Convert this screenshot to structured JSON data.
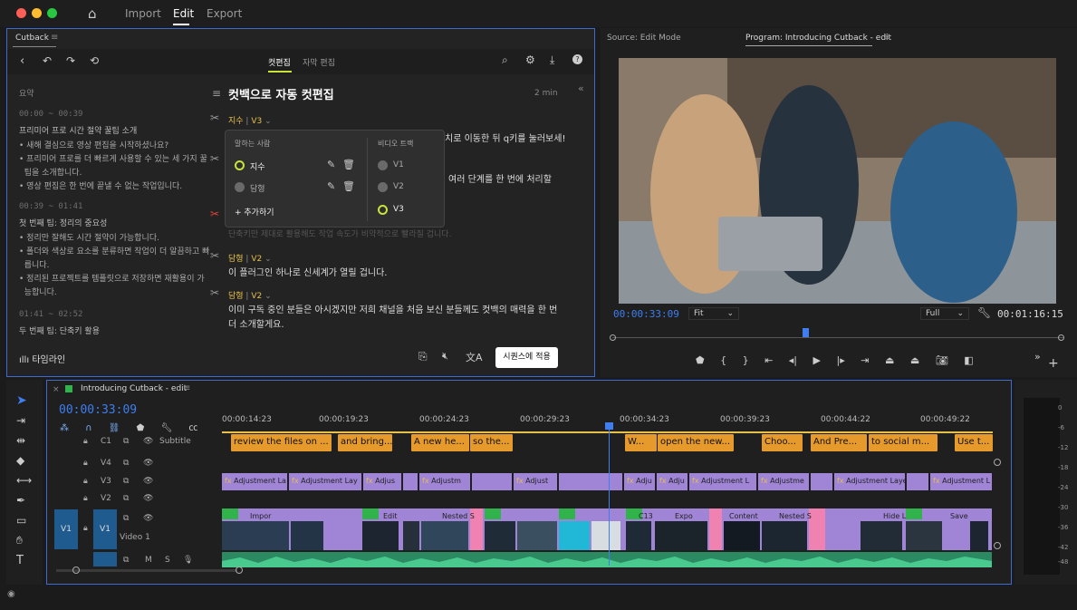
{
  "nav": {
    "import": "Import",
    "edit": "Edit",
    "export": "Export"
  },
  "cutback": {
    "panel_tab": "Cutback",
    "tab_cut": "컷편집",
    "tab_subtitle": "자막 편집",
    "summary_label": "요약",
    "title": "컷백으로 자동 컷편집",
    "read_time": "2 min",
    "sections": [
      {
        "time": "00:00 ~ 00:39",
        "heading": "프리미어 프로 시간 절약 꿀팁 소개",
        "bullets": [
          "새해 결심으로 영상 편집을 시작하셨나요?",
          "프리미어 프로를 더 빠르게 사용할 수 있는 세 가지 꿀",
          "팁을 소개합니다.",
          "영상 편집은 한 번에 끝낼 수 없는 작업입니다."
        ]
      },
      {
        "time": "00:39 ~ 01:41",
        "heading": "첫 번째 팁: 정리의 중요성",
        "bullets": [
          "정리만 잘해도 시간 절약이 가능합니다.",
          "폴더와 색상로 요소를 분류하면 작업이 더 알끔하고 빠",
          "릅니다.",
          "정리된 프로젝트를 템플릿으로 저장하면 재활용이 가",
          "능합니다."
        ]
      },
      {
        "time": "01:41 ~ 02:52",
        "heading": "두 번째 팁: 단축키 활용",
        "bullets": []
      }
    ],
    "transcript": [
      {
        "speaker": "지수",
        "track": "V3",
        "text": "치로 이동한 뒤 q키를 눌러보세!"
      },
      {
        "speaker": "",
        "track": "",
        "text": "여러 단계를 한 번에 처리할"
      },
      {
        "speaker": "",
        "track": "",
        "text": "단축키만 제대로 활용해도 작업 속도가 비약적으로 빨라질 겁니다."
      },
      {
        "speaker": "담형",
        "track": "V2",
        "text": "이 플러그인 하나로 신세계가 열릴 겁니다."
      },
      {
        "speaker": "담형",
        "track": "V2",
        "text": "이미 구독 중인 분들은 아시겠지만 저희 채널을 처음 보신 분들께도 컷백의 매력을 한 번",
        "text2": "더 소개할게요."
      }
    ],
    "popup": {
      "speakers_label": "말하는 사람",
      "tracks_label": "비디오 트랙",
      "speaker1": "지수",
      "speaker2": "담형",
      "add": "+ 추가하기",
      "v1": "V1",
      "v2": "V2",
      "v3": "V3"
    },
    "timeline_label": "타임라인",
    "apply_button": "시퀀스에 적용"
  },
  "program": {
    "source_tab": "Source: Edit Mode",
    "program_tab": "Program: Introducing Cutback - edit",
    "timecode": "00:00:33:09",
    "fit": "Fit",
    "full": "Full",
    "duration": "00:01:16:15"
  },
  "timeline": {
    "tab": "Introducing Cutback - edit",
    "timecode": "00:00:33:09",
    "ruler": [
      "00:00:14:23",
      "00:00:19:23",
      "00:00:24:23",
      "00:00:29:23",
      "00:00:34:23",
      "00:00:39:23",
      "00:00:44:22",
      "00:00:49:22"
    ],
    "tracks": {
      "c1": "C1",
      "subtitle": "Subtitle",
      "v4": "V4",
      "v3": "V3",
      "v2": "V2",
      "v1": "V1",
      "video1": "Video 1",
      "v1src": "V1",
      "m": "M",
      "s": "S"
    },
    "subtitles": [
      "review the files on ...",
      "and bring...",
      "A new he...",
      "so the...",
      "W...",
      "open the new...",
      "Choo...",
      "And Pre...",
      "to social m...",
      "Use t..."
    ],
    "adjust_clips": [
      "Adjustment La",
      "Adjustment Lay",
      "Adjus",
      "Adjustm",
      "Adjust",
      "Adju",
      "Adju",
      "Adjustment L",
      "Adjustme",
      "Adjustment Layer",
      "Adjustment L"
    ],
    "video_clips": [
      "Impor",
      "Edit",
      "Nested S",
      "C13",
      "Expo",
      "Content",
      "Nested S",
      "Hide L",
      "Save"
    ],
    "fx": "fx"
  },
  "meter": {
    "labels": [
      "0",
      "-6",
      "-12",
      "-18",
      "-24",
      "-30",
      "-36",
      "-42",
      "-48"
    ]
  }
}
